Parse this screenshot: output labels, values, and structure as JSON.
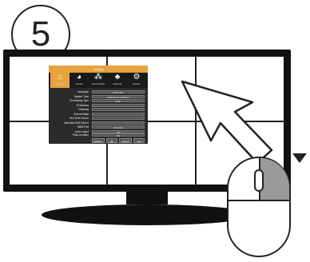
{
  "step": {
    "number": "5"
  },
  "dialog": {
    "title": "Setting",
    "tabs": [
      {
        "label": "General",
        "icon": "home-icon"
      },
      {
        "label": "Set All",
        "icon": "gauge-icon"
      },
      {
        "label": "Record Plan",
        "icon": "network-tree-icon"
      },
      {
        "label": "Network",
        "icon": "bell-icon"
      },
      {
        "label": "System",
        "icon": "gear-icon"
      }
    ],
    "fields": [
      {
        "label": "Language",
        "value": "ENGLISH"
      },
      {
        "label": "System Time",
        "value": "2018-04-24 16:05:27"
      },
      {
        "label": "Timesetting Type",
        "value": "NTP"
      },
      {
        "label": "IP Address",
        "value": ""
      },
      {
        "label": "Gateway",
        "value": ""
      },
      {
        "label": "Subnet Mask",
        "value": ""
      },
      {
        "label": "First DNS Server",
        "value": ""
      },
      {
        "label": "Alternate DNS Server",
        "value": ""
      },
      {
        "label": "WEB Port",
        "value": "Disabled"
      },
      {
        "label": "Auto Logout",
        "value": "30"
      },
      {
        "label": "Pass Duration",
        "value": "30"
      }
    ],
    "buttons": {
      "default": "Default",
      "ok": "OK",
      "cancel": "Cancel",
      "apply": "App"
    }
  },
  "colors": {
    "accent": "#e6a23c",
    "panel": "#2b2b2b",
    "bezel": "#111111",
    "mouse_right": "#9a9a9a"
  }
}
